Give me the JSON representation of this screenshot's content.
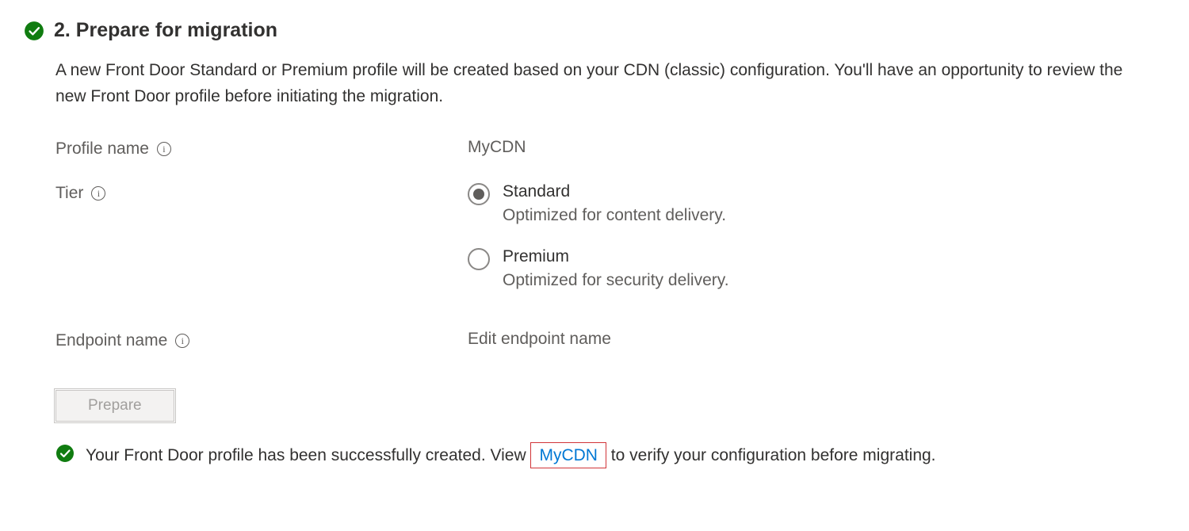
{
  "section": {
    "title": "2. Prepare for migration",
    "description": "A new Front Door Standard or Premium profile will be created based on your CDN (classic) configuration. You'll have an opportunity to review the new Front Door profile before initiating the migration."
  },
  "form": {
    "profile_name": {
      "label": "Profile name",
      "value": "MyCDN"
    },
    "tier": {
      "label": "Tier",
      "options": [
        {
          "name": "Standard",
          "desc": "Optimized for content delivery.",
          "selected": true
        },
        {
          "name": "Premium",
          "desc": "Optimized for security delivery.",
          "selected": false
        }
      ]
    },
    "endpoint_name": {
      "label": "Endpoint name",
      "value": "Edit endpoint name"
    }
  },
  "buttons": {
    "prepare": "Prepare"
  },
  "status": {
    "prefix": "Your Front Door profile has been successfully created. View ",
    "link": "MyCDN",
    "suffix": " to verify your configuration before migrating."
  }
}
